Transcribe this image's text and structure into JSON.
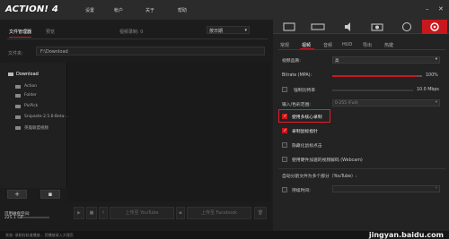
{
  "app": {
    "logo_text": "ACTION! 4"
  },
  "menu": {
    "items": [
      {
        "label": "设置"
      },
      {
        "label": "帐户"
      },
      {
        "label": "关于"
      },
      {
        "label": "帮助"
      }
    ]
  },
  "left": {
    "tabs": {
      "file_manager": "文件管理器",
      "preview": "预览"
    },
    "recording_label": "视频录制: 0",
    "date_dropdown": "按日期",
    "folder_label": "文件夹:",
    "path_value": "F:\\Download",
    "tree": {
      "root": "Download",
      "children": [
        "Action",
        "Folder",
        "PicPick",
        "Snipaste-2.5.6-Beta-...",
        "英雄联盟视频"
      ]
    },
    "free_space_label": "可用磁盘空间:",
    "free_space_value": "225.1 GB",
    "add_button": "+",
    "controls": {
      "upload_youtube": "上传至 YouTube",
      "upload_facebook": "上传至 Facebook"
    }
  },
  "right": {
    "subtabs": [
      "常规",
      "视频",
      "音频",
      "HUD",
      "导出",
      "热键"
    ],
    "active_subtab": "视频",
    "video_quality_label": "视频品质:",
    "video_quality_value": "高",
    "bitrate_label": "Bitrate (MPA):",
    "bitrate_value": "100%",
    "bitrate_fraction": 0.94,
    "force_bitrate_label": "强制比特率",
    "force_bitrate_value": "10.0 Mbps",
    "input_range_label": "输入/色彩范围:",
    "input_range_value": "0-255 (Full)",
    "opt_multicore": "使用多核心录制",
    "opt_mouse": "录制鼠标指针",
    "opt_hide_window": "隐藏化鼠标点击",
    "opt_webcam": "使用硬件加速的视频解码 (Webcam)",
    "split_label": "自动分割文件为多个部分（YouTube）:",
    "duration_label": "持续时间:"
  },
  "status": {
    "text": "状态:  录制在轨道播放...  您播放录入大理页"
  },
  "watermark": {
    "text": "jingyan.baidu.com"
  },
  "colors": {
    "accent": "#c8181e"
  }
}
